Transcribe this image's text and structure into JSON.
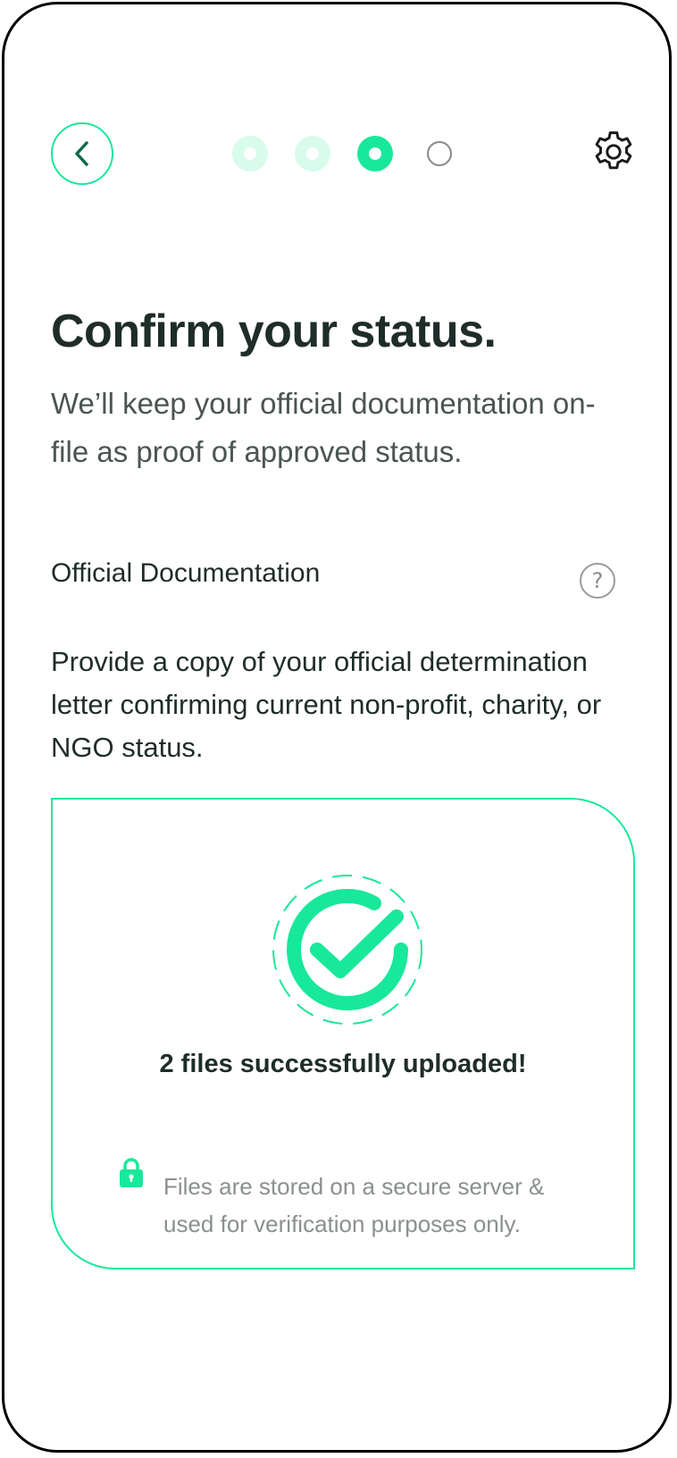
{
  "header": {
    "back_icon": "chevron-left-icon",
    "settings_icon": "gear-icon",
    "steps": [
      {
        "state": "done"
      },
      {
        "state": "done"
      },
      {
        "state": "active"
      },
      {
        "state": "todo"
      }
    ],
    "progress": {
      "current_step": 3,
      "total_steps": 4
    }
  },
  "main": {
    "title": "Confirm your status.",
    "subtitle": "We’ll keep your official documentation on-file as proof of approved status.",
    "section_label": "Official Documentation",
    "help_icon": "question-circle-icon",
    "help_glyph": "?",
    "description": "Provide a copy of your official determination letter confirming current non-profit, charity, or NGO status."
  },
  "upload": {
    "status_icon": "check-circle-icon",
    "success_text": "2 files successfully uploaded!",
    "lock_icon": "lock-icon",
    "secure_note": "Files are stored on a secure server & used for verification purposes only."
  },
  "colors": {
    "accent": "#18e89a",
    "accent_light": "#d8fbec",
    "text_primary": "#1f2d2a",
    "text_secondary": "#4a5553",
    "text_muted": "#8a908f"
  }
}
